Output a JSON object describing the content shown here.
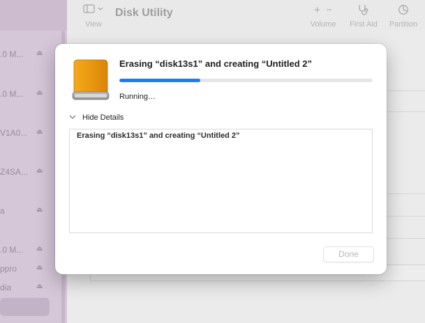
{
  "app": {
    "title": "Disk Utility"
  },
  "toolbar": {
    "view_label": "View",
    "volume_label": "Volume",
    "first_aid_label": "First Aid",
    "partition_label": "Partition",
    "add_glyph": "+",
    "remove_glyph": "−"
  },
  "sidebar": {
    "items": [
      {
        "label": ".0 M...",
        "icon": "eject-icon"
      },
      {
        "label": ".0 M...",
        "icon": "eject-icon"
      },
      {
        "label": "V1A0...",
        "icon": "eject-icon"
      },
      {
        "label": "Z4SA...",
        "icon": "eject-icon"
      },
      {
        "label": "a",
        "icon": "eject-icon"
      },
      {
        "label": ".0 M...",
        "icon": "eject-icon"
      },
      {
        "label": "ppro",
        "icon": "eject-icon"
      },
      {
        "label": "dia",
        "icon": "eject-icon"
      }
    ]
  },
  "dialog": {
    "icon": "external-drive-icon",
    "title": "Erasing “disk13s1” and creating “Untitled 2”",
    "progress_fraction": 0.32,
    "status": "Running…",
    "details_toggle_label": "Hide Details",
    "details_log": "Erasing “disk13s1” and creating “Untitled 2”",
    "done_label": "Done"
  },
  "colors": {
    "accent": "#1b7cf2",
    "drive": "#e89a12"
  }
}
